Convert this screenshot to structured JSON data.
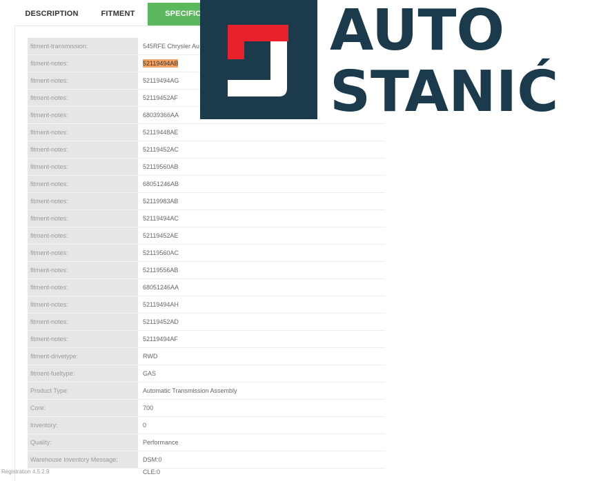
{
  "tabs": [
    {
      "label": "DESCRIPTION"
    },
    {
      "label": "FITMENT"
    },
    {
      "label": "SPECIFICATI"
    }
  ],
  "specs": [
    {
      "label": "fitment-transmission:",
      "value": "545RFE Chrysler Au"
    },
    {
      "label": "fitment-notes:",
      "value": "52119494AB"
    },
    {
      "label": "fitment-notes:",
      "value": "52119494AG"
    },
    {
      "label": "fitment-notes:",
      "value": "52119452AF"
    },
    {
      "label": "fitment-notes:",
      "value": "68039366AA"
    },
    {
      "label": "fitment-notes:",
      "value": "52119448AE"
    },
    {
      "label": "fitment-notes:",
      "value": "52119452AC"
    },
    {
      "label": "fitment-notes:",
      "value": "52119560AB"
    },
    {
      "label": "fitment-notes:",
      "value": "68051246AB"
    },
    {
      "label": "fitment-notes:",
      "value": "52119983AB"
    },
    {
      "label": "fitment-notes:",
      "value": "52119494AC"
    },
    {
      "label": "fitment-notes:",
      "value": "52119452AE"
    },
    {
      "label": "fitment-notes:",
      "value": "52119560AC"
    },
    {
      "label": "fitment-notes:",
      "value": "52119556AB"
    },
    {
      "label": "fitment-notes:",
      "value": "68051246AA"
    },
    {
      "label": "fitment-notes:",
      "value": "52119494AH"
    },
    {
      "label": "fitment-notes:",
      "value": "52119452AD"
    },
    {
      "label": "fitment-notes:",
      "value": "52119494AF"
    },
    {
      "label": "fitment-drivetype:",
      "value": "RWD"
    },
    {
      "label": "fitment-fueltype:",
      "value": "GAS"
    },
    {
      "label": "Product Type:",
      "value": "Automatic Transmission Assembly"
    },
    {
      "label": "Core:",
      "value": "700"
    },
    {
      "label": "Inventory:",
      "value": "0"
    },
    {
      "label": "Quality:",
      "value": "Performance"
    },
    {
      "label": "Warehouse Inventory Message:",
      "value": "DSM:0"
    }
  ],
  "extra_value": "CLE:0",
  "logo": {
    "line1": "AUTO",
    "line2": "STANIĆ",
    "colors": {
      "navy": "#1b3a4b",
      "red": "#e8202a"
    }
  },
  "footer": {
    "version": "Registration 4.5.2.9"
  },
  "highlighted_value": "52119494AB",
  "accent": "#5cb85c"
}
